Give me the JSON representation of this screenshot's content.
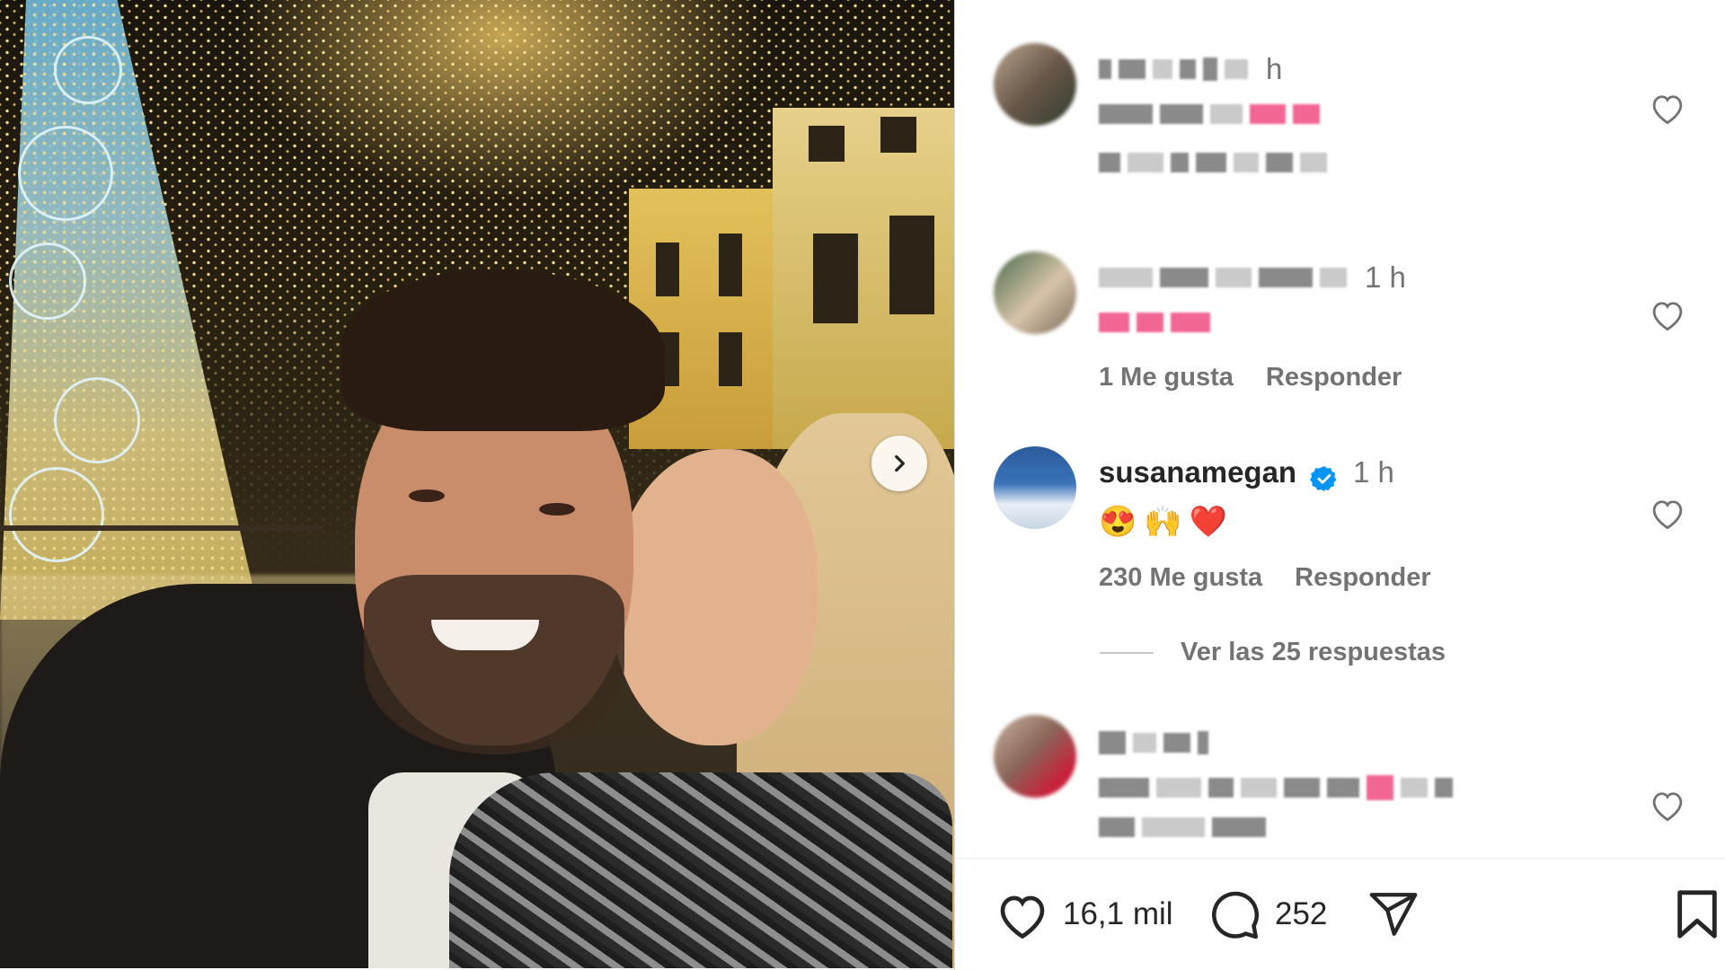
{
  "post": {
    "carousel_next_icon": "chevron-right-icon"
  },
  "comments": [
    {
      "id": "c1",
      "username_hidden": true,
      "time": "h",
      "text_hidden": true,
      "hidden_second_line": true
    },
    {
      "id": "c2",
      "username_hidden": true,
      "time": "1 h",
      "text_hidden": true,
      "likes": "1 Me gusta",
      "reply": "Responder"
    },
    {
      "id": "c3",
      "username": "susanamegan",
      "verified": true,
      "time": "1 h",
      "emojis": "😍🙌❤️",
      "likes": "230 Me gusta",
      "reply": "Responder",
      "view_replies": "Ver las 25 respuestas"
    },
    {
      "id": "c4",
      "username_hidden": true,
      "text_hidden": true
    }
  ],
  "actions": {
    "like_icon": "heart-outline-icon",
    "likes_count": "16,1 mil",
    "comment_icon": "comment-icon",
    "comments_count": "252",
    "share_icon": "paper-plane-icon",
    "save_icon": "bookmark-icon"
  },
  "colors": {
    "text": "#262626",
    "secondary": "#737373",
    "verified": "#0095f6",
    "divider": "#dbdbdb"
  }
}
